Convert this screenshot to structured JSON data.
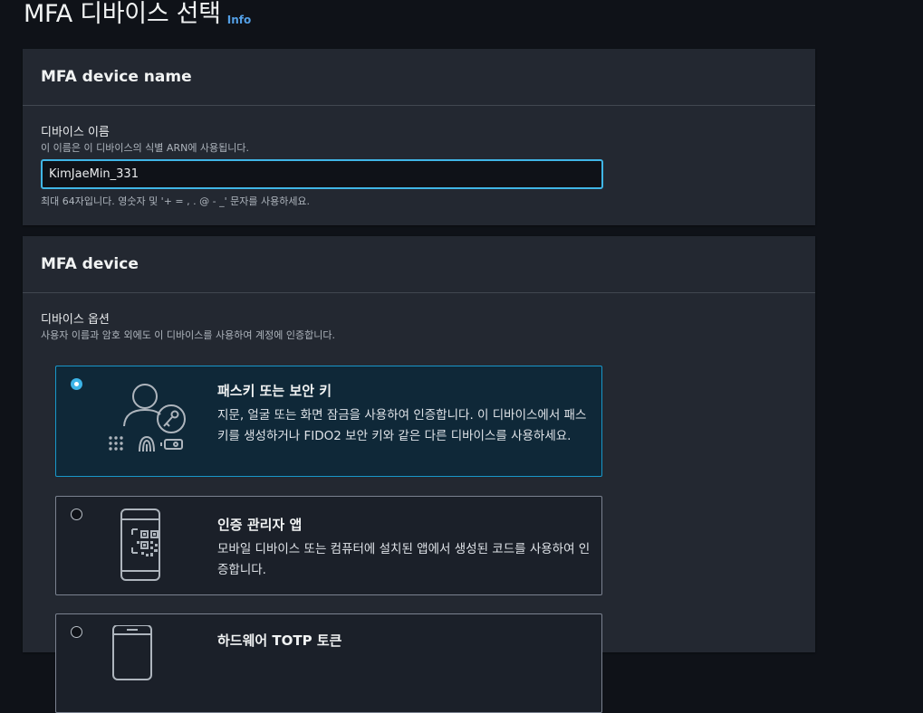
{
  "header": {
    "title": "MFA 디바이스 선택",
    "info_link": "Info"
  },
  "name_section": {
    "title": "MFA device name",
    "field_label": "디바이스 이름",
    "field_description": "이 이름은 이 디바이스의 식별 ARN에 사용됩니다.",
    "input_value": "KimJaeMin_331",
    "constraint_text": "최대 64자입니다. 영숫자 및 '+ = , . @ - _' 문자를 사용하세요."
  },
  "device_section": {
    "title": "MFA device",
    "options_label": "디바이스 옵션",
    "options_description": "사용자 이름과 암호 외에도 이 디바이스를 사용하여 계정에 인증합니다.",
    "options": [
      {
        "title": "패스키 또는 보안 키",
        "description": "지문, 얼굴 또는 화면 잠금을 사용하여 인증합니다. 이 디바이스에서 패스키를 생성하거나 FIDO2 보안 키와 같은 다른 디바이스를 사용하세요.",
        "selected": true,
        "icon": "passkey-security-key-icon"
      },
      {
        "title": "인증 관리자 앱",
        "description": "모바일 디바이스 또는 컴퓨터에 설치된 앱에서 생성된 코드를 사용하여 인증합니다.",
        "selected": false,
        "icon": "authenticator-app-icon"
      },
      {
        "title": "하드웨어 TOTP 토큰",
        "description": "",
        "selected": false,
        "icon": "hardware-token-icon"
      }
    ]
  },
  "colors": {
    "page_bg": "#0f1218",
    "card_bg": "#232831",
    "accent": "#3cb4e7",
    "selected_bg": "#0f2838",
    "link": "#539fe5"
  }
}
